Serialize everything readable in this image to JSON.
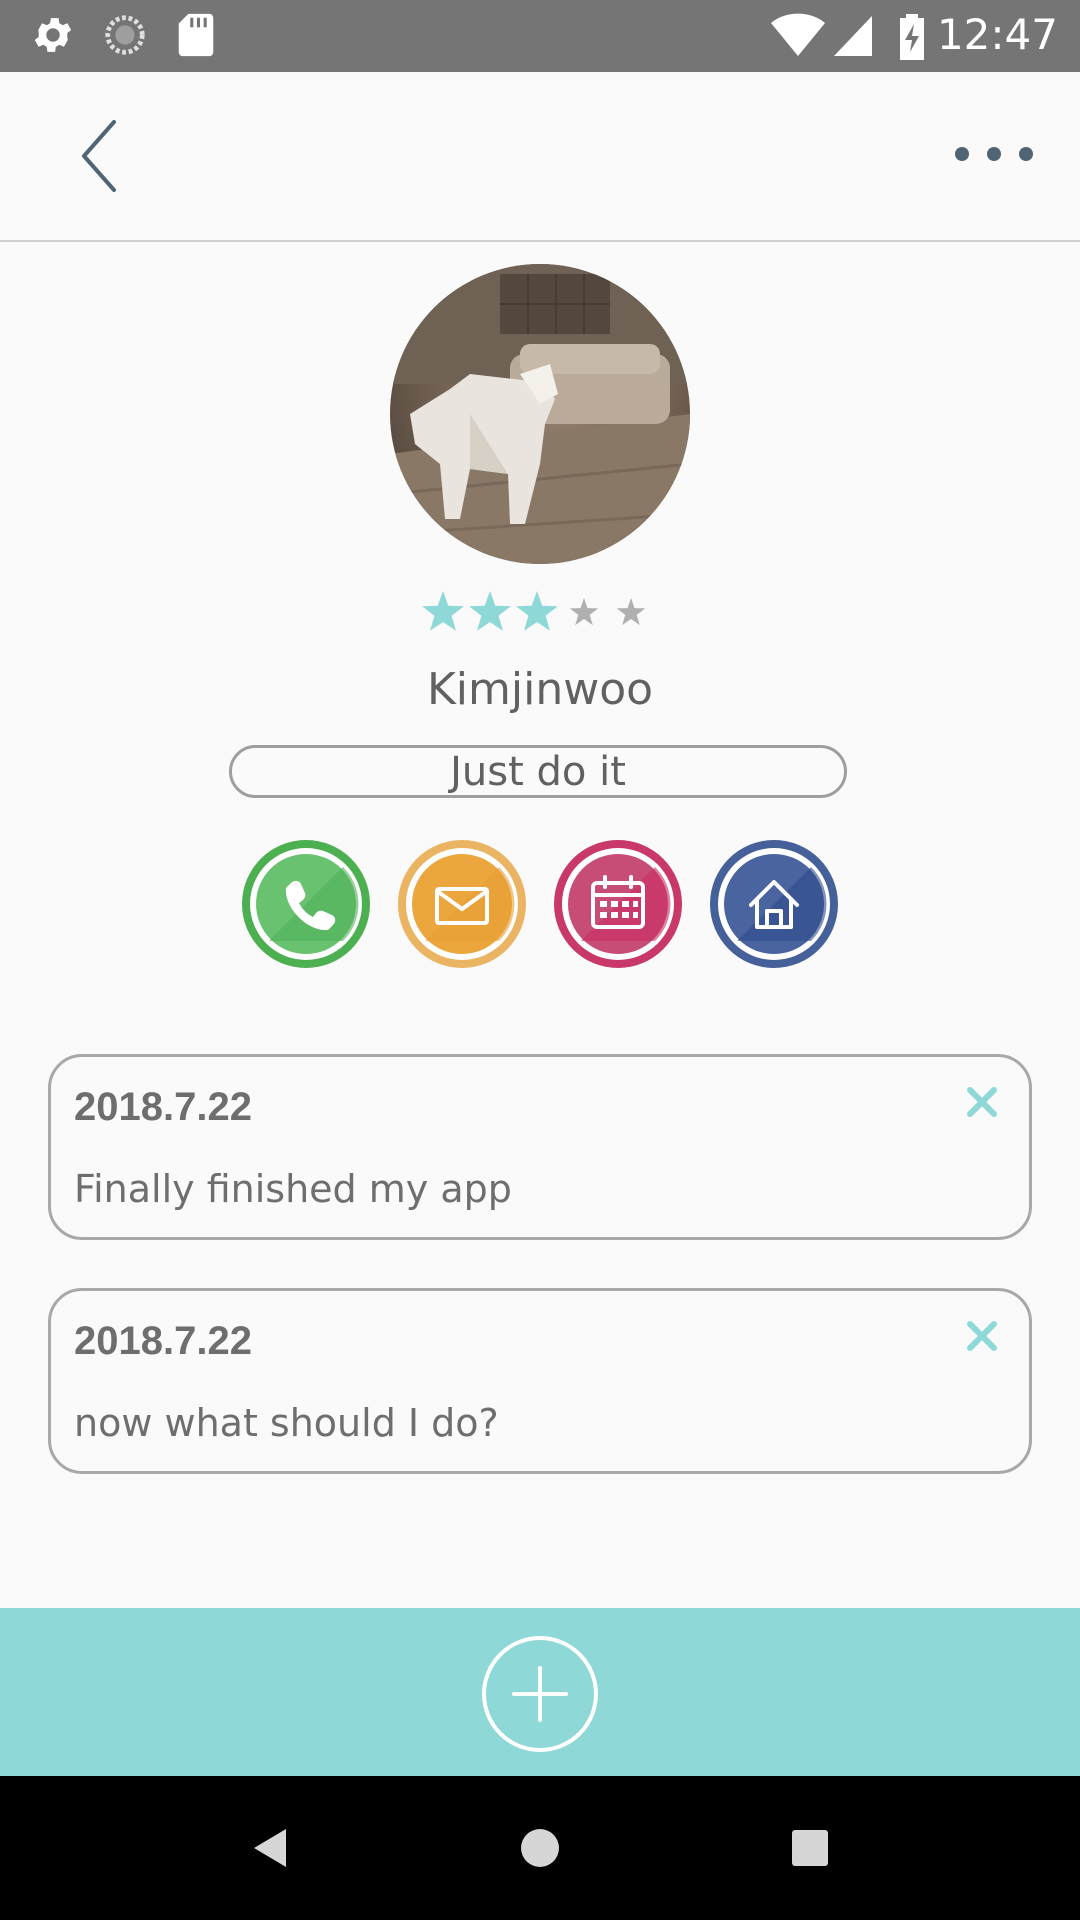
{
  "status_bar": {
    "time": "12:47",
    "icons": [
      "settings-icon",
      "sync-icon",
      "sd-card-icon",
      "wifi-icon",
      "signal-icon",
      "battery-charging-icon"
    ]
  },
  "header": {
    "back_icon": "chevron-left-icon",
    "more_icon": "more-horizontal-icon"
  },
  "profile": {
    "name": "Kimjinwoo",
    "status": "Just do it",
    "rating": {
      "value": 3,
      "max": 5
    },
    "avatar": "photo of a low-poly dog in a living room"
  },
  "actions": [
    {
      "name": "phone",
      "icon": "phone-icon",
      "color": "#4caf50"
    },
    {
      "name": "mail",
      "icon": "mail-icon",
      "color": "#e8a33c"
    },
    {
      "name": "calendar",
      "icon": "calendar-icon",
      "color": "#c62860"
    },
    {
      "name": "home",
      "icon": "home-icon",
      "color": "#2f4a8a"
    }
  ],
  "notes": [
    {
      "date": "2018.7.22",
      "text": "Finally finished my app"
    },
    {
      "date": "2018.7.22",
      "text": "now what should I do?"
    }
  ],
  "colors": {
    "accent": "#8fd8d8",
    "star_filled": "#8fd8d8",
    "star_empty": "#b0b0b0"
  },
  "nav": [
    "back-icon",
    "home-icon",
    "recents-icon"
  ]
}
